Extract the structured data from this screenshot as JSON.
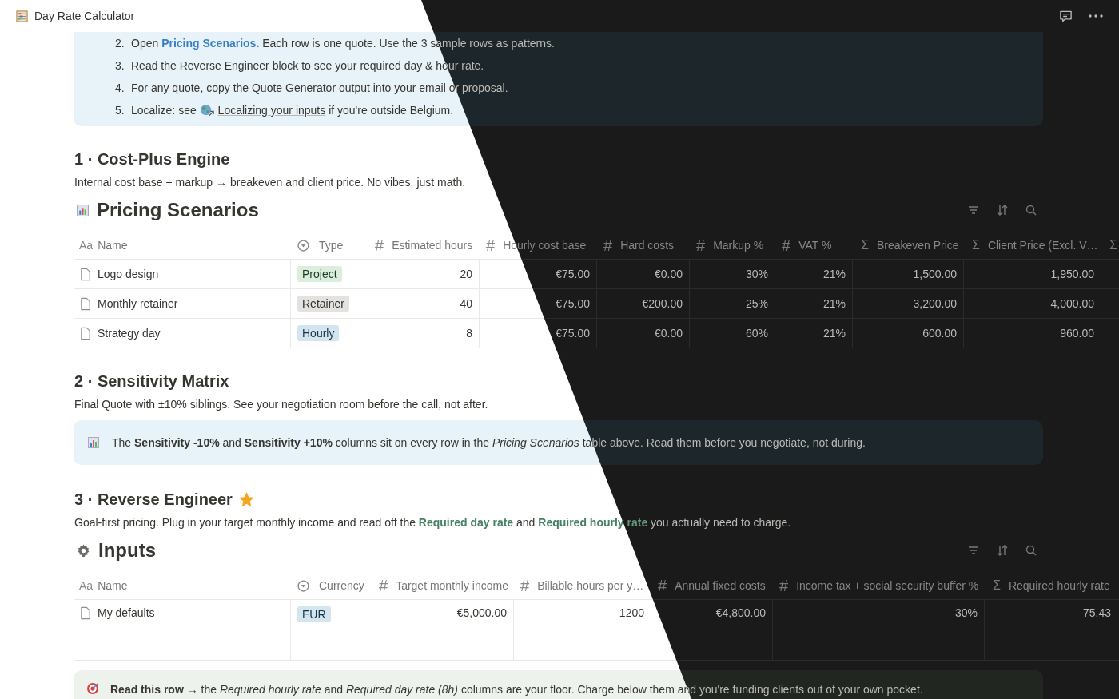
{
  "top_bar": {
    "title": "Day Rate Calculator"
  },
  "intro_callout": {
    "items": [
      {
        "number": "2.",
        "before": "Open ",
        "link": "Pricing Scenarios.",
        "link_underlined": false,
        "after": " Each row is one quote. Use the 3 sample rows as patterns."
      },
      {
        "number": "3.",
        "before": "Read the Reverse Engineer block to see your required day & hour rate."
      },
      {
        "number": "4.",
        "before": "For any quote, copy the Quote Generator output into your email or proposal."
      },
      {
        "number": "5.",
        "before": "Localize: see ",
        "link": "Localizing your inputs",
        "link_underlined": true,
        "after": " if you're outside Belgium."
      }
    ]
  },
  "section_1": {
    "heading": "1 · Cost-Plus Engine",
    "description": "Internal cost base + markup → breakeven and client price. No vibes, just math."
  },
  "pricing_table": {
    "title": "Pricing Scenarios",
    "columns": [
      {
        "kind": "title",
        "icon": "Aa",
        "label": "Name"
      },
      {
        "kind": "select",
        "label": "Type"
      },
      {
        "kind": "number",
        "icon": "#",
        "label": "Estimated hours"
      },
      {
        "kind": "number",
        "icon": "#",
        "label": "Hourly cost base"
      },
      {
        "kind": "number",
        "icon": "#",
        "label": "Hard costs"
      },
      {
        "kind": "number",
        "icon": "#",
        "label": "Markup %"
      },
      {
        "kind": "number",
        "icon": "#",
        "label": "VAT %"
      },
      {
        "kind": "formula",
        "icon": "Σ",
        "label": "Breakeven Price"
      },
      {
        "kind": "formula",
        "icon": "Σ",
        "label": "Client Price (Excl. V…"
      },
      {
        "kind": "formula",
        "icon": "Σ"
      }
    ],
    "rows": [
      {
        "cells": [
          "Logo design",
          {
            "tag": "Project",
            "color": "#dbeddb"
          },
          "20",
          "€75.00",
          "€0.00",
          "30%",
          "21%",
          "1,500.00",
          "1,950.00"
        ]
      },
      {
        "cells": [
          "Monthly retainer",
          {
            "tag": "Retainer",
            "color": "#e3e2e0"
          },
          "40",
          "€75.00",
          "€200.00",
          "25%",
          "21%",
          "3,200.00",
          "4,000.00"
        ]
      },
      {
        "cells": [
          "Strategy day",
          {
            "tag": "Hourly",
            "color": "#d3e5ef"
          },
          "8",
          "€75.00",
          "€0.00",
          "60%",
          "21%",
          "600.00",
          "960.00"
        ]
      }
    ]
  },
  "section_2": {
    "heading": "2 · Sensitivity Matrix",
    "description": "Final Quote with ±10% siblings. See your negotiation room before the call, not after.",
    "callout": {
      "text": "The **Sensitivity -10%** and **Sensitivity +10%** columns sit on every row in the *Pricing Scenarios* table above. Read them before you negotiate, not during."
    }
  },
  "section_3": {
    "heading": "3 · Reverse Engineer",
    "description": "Goal-first pricing. Plug in your target monthly income and read off the **Required day rate** and **Required hourly rate** you actually need to charge."
  },
  "inputs_table": {
    "title": "Inputs",
    "columns": [
      {
        "kind": "title",
        "icon": "Aa",
        "label": "Name"
      },
      {
        "kind": "select",
        "label": "Currency"
      },
      {
        "kind": "number",
        "icon": "#",
        "label": "Target monthly income"
      },
      {
        "kind": "number",
        "icon": "#",
        "label": "Billable hours per y…"
      },
      {
        "kind": "number",
        "icon": "#",
        "label": "Annual fixed costs"
      },
      {
        "kind": "number",
        "icon": "#",
        "label": "Income tax + social security buffer %"
      },
      {
        "kind": "formula",
        "icon": "Σ",
        "label": "Required hourly rate"
      }
    ],
    "rows": [
      {
        "cells": [
          "My defaults",
          {
            "tag": "EUR",
            "color": "#d3e5ef"
          },
          "€5,000.00",
          "1200",
          "€4,800.00",
          "30%",
          "75.43"
        ]
      }
    ]
  },
  "floor_callout": {
    "text": "**Read this row** → the *Required hourly rate* and *Required day rate (8h)* columns are your floor. Charge below them and you're funding clients out of your own pocket."
  }
}
